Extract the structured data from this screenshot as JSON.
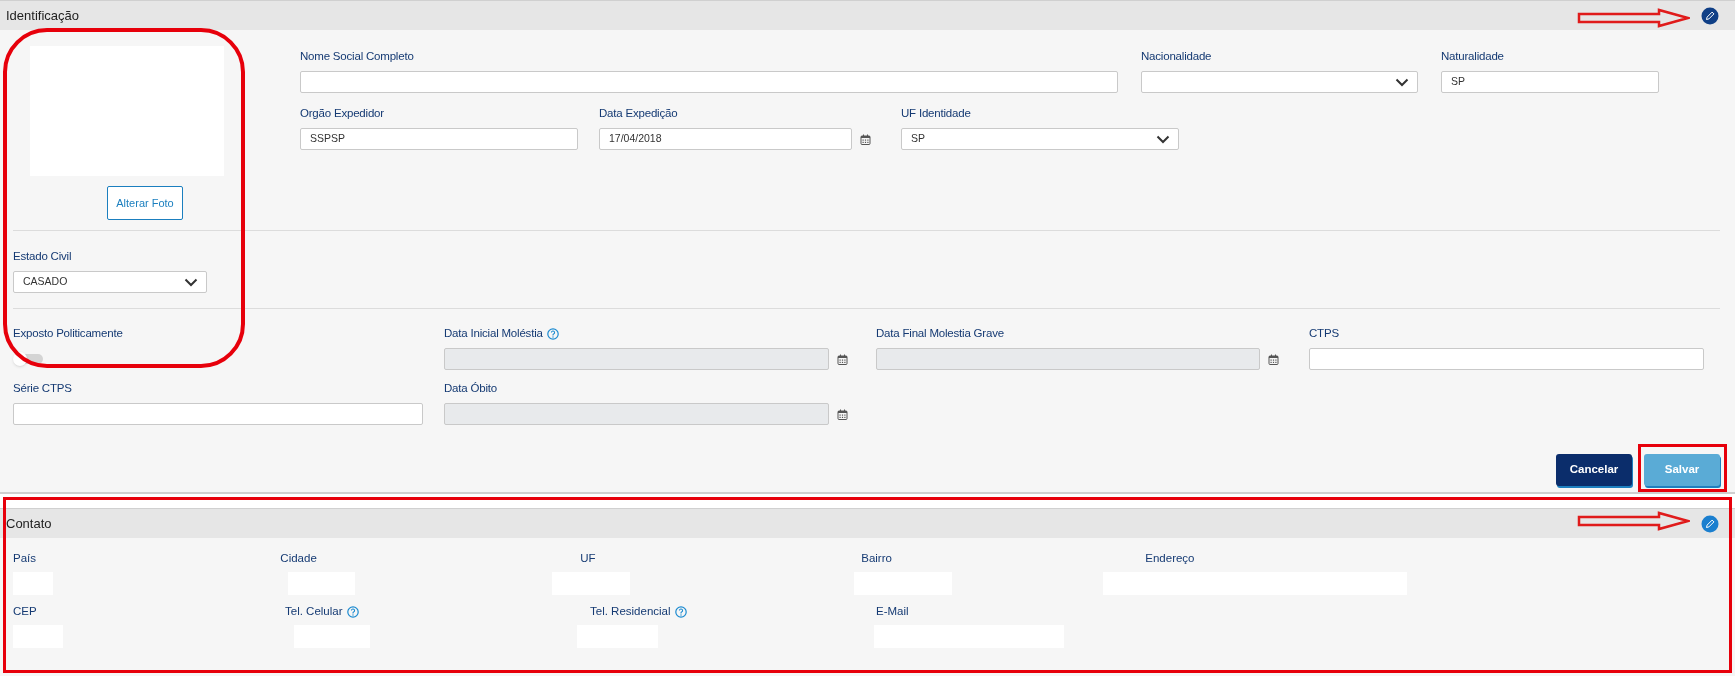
{
  "identificacao": {
    "title": "Identificação",
    "photo_button": "Alterar Foto",
    "top_row_1": [
      {
        "kind": "text",
        "label": "Nome Social Completo"
      },
      {
        "kind": "select",
        "label": "Nacionalidade"
      },
      {
        "kind": "text",
        "label": "Naturalidade",
        "value": "SP"
      }
    ],
    "top_row_2": [
      {
        "kind": "text",
        "label": "Orgão Expedidor",
        "value": "SSPSP"
      },
      {
        "kind": "date",
        "label": "Data Expedição",
        "value": "17/04/2018",
        "disabled": false
      },
      {
        "kind": "select",
        "label": "UF Identidade",
        "value": "SP"
      }
    ],
    "estado_civil": {
      "kind": "select",
      "label": "Estado Civil",
      "value": "CASADO"
    },
    "bottom_fields": [
      {
        "kind": "toggle",
        "label": "Exposto Politicamente",
        "on": false
      },
      {
        "kind": "date",
        "label": "Data Inicial Moléstia",
        "help": true,
        "disabled": true
      },
      {
        "kind": "date",
        "label": "Data Final Molestia Grave",
        "disabled": true
      },
      {
        "kind": "text",
        "label": "CTPS"
      },
      {
        "kind": "text",
        "label": "Série CTPS"
      },
      {
        "kind": "date",
        "label": "Data Óbito",
        "disabled": true
      }
    ],
    "buttons": [
      {
        "label": "Cancelar",
        "kind": "secondary"
      },
      {
        "label": "Salvar",
        "kind": "primary"
      }
    ]
  },
  "contato": {
    "title": "Contato",
    "fields": [
      {
        "label": "País"
      },
      {
        "label": "Cidade"
      },
      {
        "label": "UF"
      },
      {
        "label": "Bairro"
      },
      {
        "label": "Endereço"
      },
      {
        "label": "CEP"
      },
      {
        "label": "Tel. Celular",
        "help": true
      },
      {
        "label": "Tel. Residencial",
        "help": true
      },
      {
        "label": "E-Mail"
      }
    ]
  }
}
